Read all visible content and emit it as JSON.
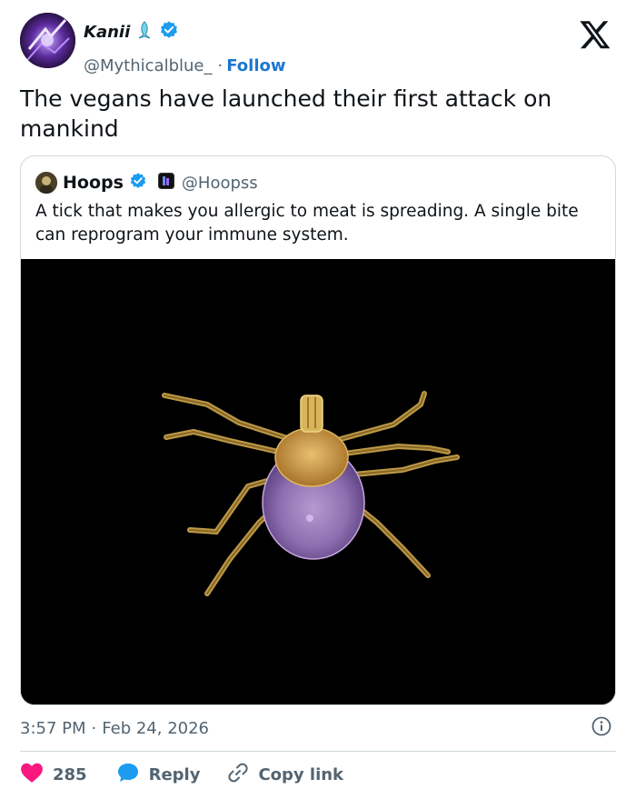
{
  "author": {
    "display_name": "Kanii",
    "handle": "@Mythicalblue_",
    "separator": "·",
    "follow_label": "Follow"
  },
  "tweet": {
    "text": "The vegans have launched their first attack on mankind"
  },
  "quote": {
    "display_name": "Hoops",
    "handle": "@Hoopss",
    "text": "A tick that makes you allergic to meat is spreading. A single bite can reprogram your immune system."
  },
  "meta": {
    "time": "3:57 PM",
    "separator": "·",
    "date": "Feb 24, 2026"
  },
  "actions": {
    "like_count": "285",
    "reply_label": "Reply",
    "copy_label": "Copy link"
  },
  "colors": {
    "like": "#f91880",
    "reply": "#1d9bf0",
    "verified": "#1d9bf0",
    "follow": "#1d76d2",
    "muted": "#536471",
    "border": "#cfd9de"
  },
  "icons": [
    "mermaid-emoji-icon",
    "verified-badge-icon",
    "x-logo-icon",
    "affiliate-badge-icon",
    "info-icon",
    "heart-icon",
    "reply-bubble-icon",
    "link-icon"
  ]
}
